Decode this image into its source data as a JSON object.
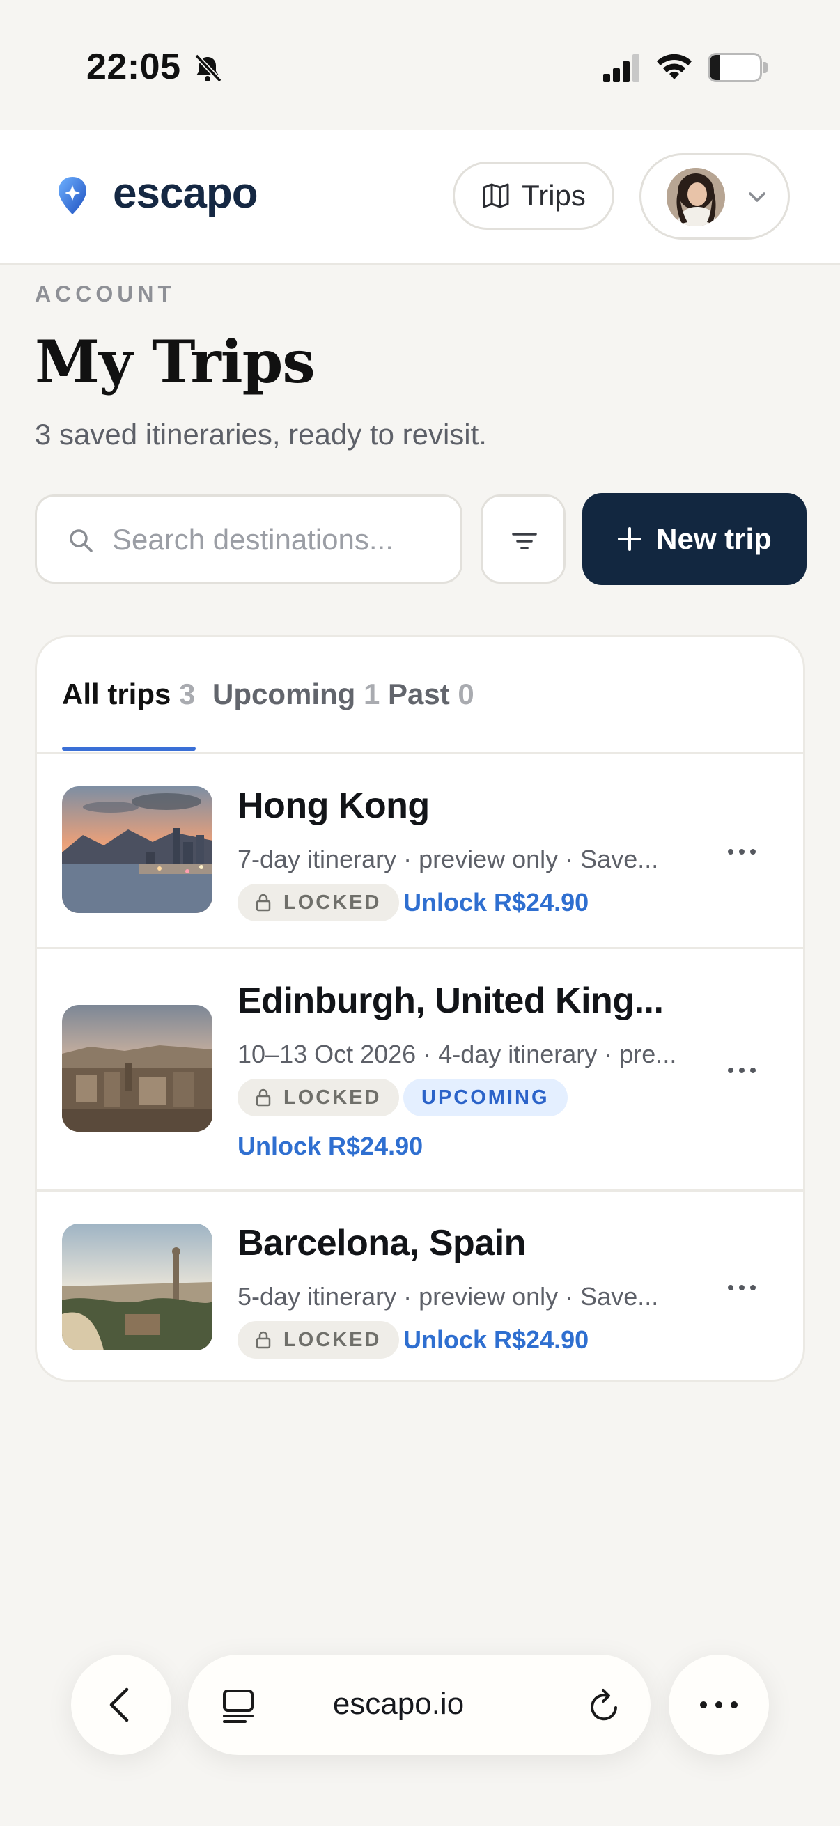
{
  "status_bar": {
    "time": "22:05",
    "battery": "21",
    "battery_level": 0.21
  },
  "header": {
    "brand": "escapo",
    "trips_button_label": "Trips",
    "colors": {
      "brand_navy": "#152843",
      "accent_blue": "#3a6fd6"
    }
  },
  "page": {
    "eyebrow": "ACCOUNT",
    "title": "My Trips",
    "subtitle": "3 saved itineraries, ready to revisit."
  },
  "search": {
    "placeholder": "Search destinations...",
    "value": ""
  },
  "new_trip_button": {
    "label": "New trip"
  },
  "tabs": [
    {
      "label": "All trips",
      "count": "3",
      "active": true
    },
    {
      "label": "Upcoming",
      "count": "1",
      "active": false
    },
    {
      "label": "Past",
      "count": "0",
      "active": false
    }
  ],
  "trips": [
    {
      "title": "Hong Kong",
      "meta": "7-day itinerary · preview only · Save...",
      "badge_locked": "LOCKED",
      "unlock_label": "Unlock R$24.90"
    },
    {
      "title": "Edinburgh, United King...",
      "meta": "10–13 Oct 2026 · 4-day itinerary · pre...",
      "badge_locked": "LOCKED",
      "badge_upcoming": "UPCOMING",
      "unlock_label": "Unlock R$24.90"
    },
    {
      "title": "Barcelona, Spain",
      "meta": "5-day itinerary · preview only · Save...",
      "badge_locked": "LOCKED",
      "unlock_label": "Unlock R$24.90"
    }
  ],
  "browser": {
    "url": "escapo.io"
  }
}
